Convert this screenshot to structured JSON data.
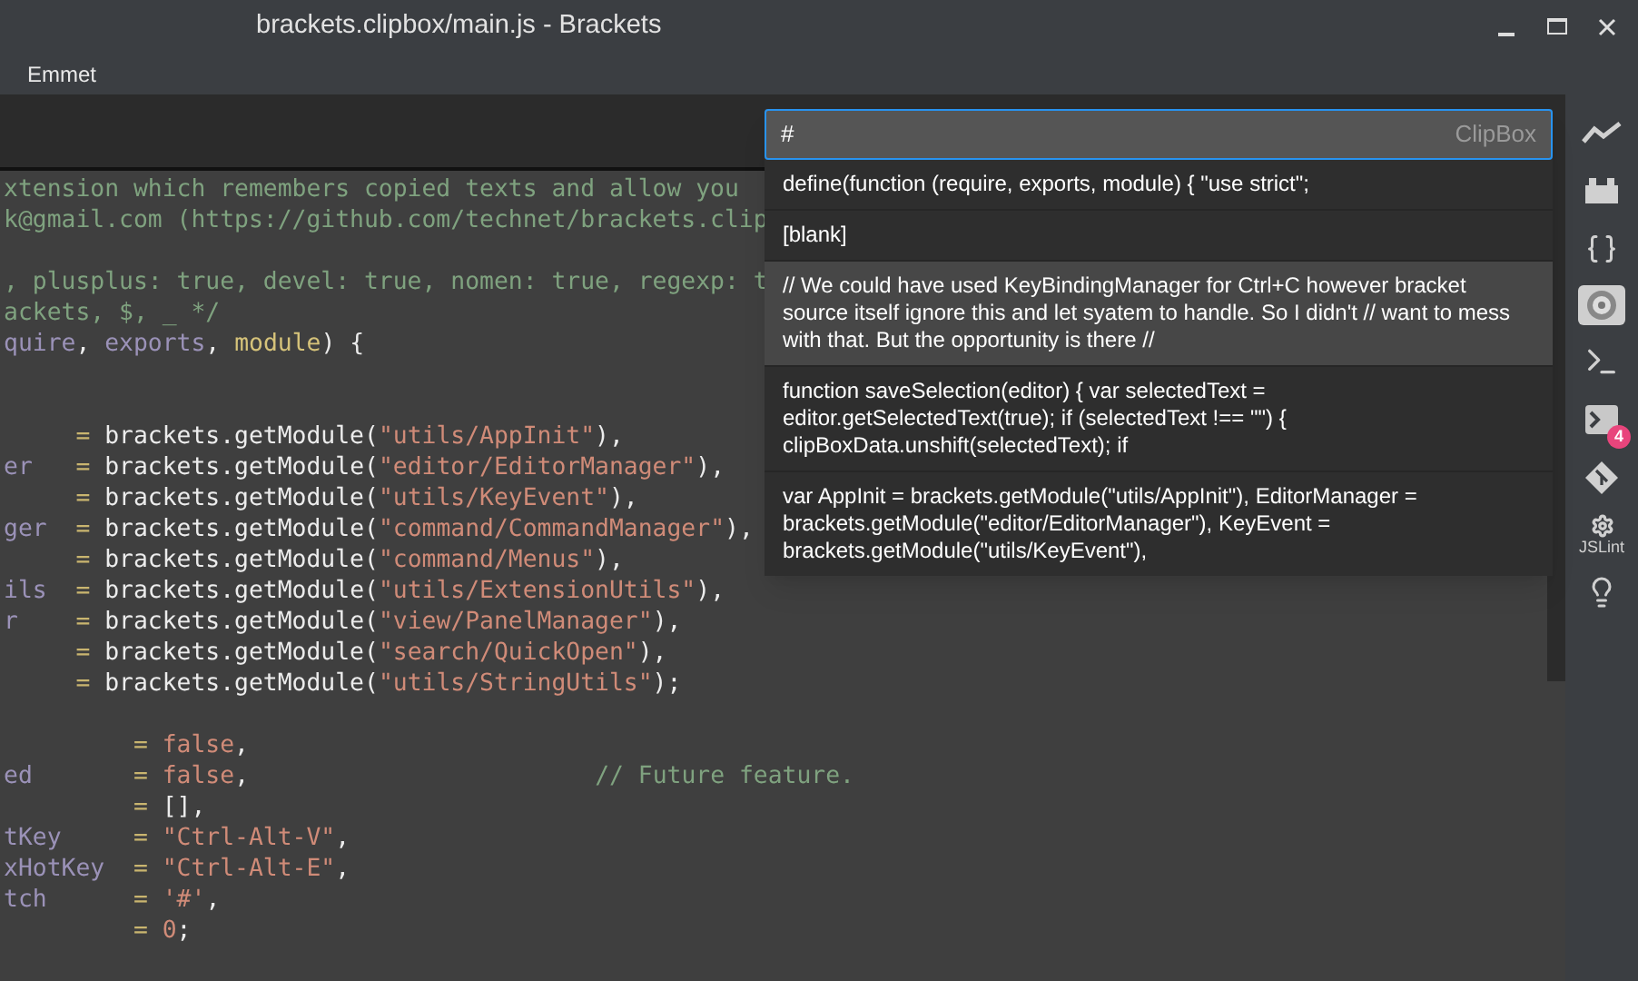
{
  "window": {
    "title": "brackets.clipbox/main.js - Brackets"
  },
  "menu": [
    {
      "label": "Emmet"
    }
  ],
  "editor": {
    "lines": [
      {
        "tokens": [
          {
            "kind": "comment",
            "text": "xtension which remembers copied texts and allow you"
          }
        ]
      },
      {
        "tokens": [
          {
            "kind": "comment",
            "text": "k@gmail.com (https://github.com/technet/brackets.clip"
          }
        ]
      },
      {
        "kind": "blank"
      },
      {
        "tokens": [
          {
            "kind": "comment",
            "text": ", plusplus: true, devel: true, nomen: true, regexp: t"
          }
        ]
      },
      {
        "tokens": [
          {
            "kind": "comment",
            "text": "ackets, $, _ */"
          }
        ]
      },
      {
        "tokens": [
          {
            "kind": "var",
            "text": "quire"
          },
          {
            "kind": "plain",
            "text": ", "
          },
          {
            "kind": "var",
            "text": "exports"
          },
          {
            "kind": "plain",
            "text": ", "
          },
          {
            "kind": "param",
            "text": "module"
          },
          {
            "kind": "plain",
            "text": ") {"
          }
        ]
      },
      {
        "kind": "blank"
      },
      {
        "kind": "blank"
      },
      {
        "tokens": [
          {
            "kind": "op",
            "text": "     = "
          },
          {
            "kind": "plain",
            "text": "brackets.getModule("
          },
          {
            "kind": "string",
            "text": "\"utils/AppInit\""
          },
          {
            "kind": "plain",
            "text": "),"
          }
        ]
      },
      {
        "tokens": [
          {
            "kind": "var",
            "text": "er"
          },
          {
            "kind": "op",
            "text": "   = "
          },
          {
            "kind": "plain",
            "text": "brackets.getModule("
          },
          {
            "kind": "string",
            "text": "\"editor/EditorManager\""
          },
          {
            "kind": "plain",
            "text": "),"
          }
        ]
      },
      {
        "tokens": [
          {
            "kind": "op",
            "text": "     = "
          },
          {
            "kind": "plain",
            "text": "brackets.getModule("
          },
          {
            "kind": "string",
            "text": "\"utils/KeyEvent\""
          },
          {
            "kind": "plain",
            "text": "),"
          }
        ]
      },
      {
        "tokens": [
          {
            "kind": "var",
            "text": "ger"
          },
          {
            "kind": "op",
            "text": "  = "
          },
          {
            "kind": "plain",
            "text": "brackets.getModule("
          },
          {
            "kind": "string",
            "text": "\"command/CommandManager\""
          },
          {
            "kind": "plain",
            "text": "),"
          }
        ]
      },
      {
        "tokens": [
          {
            "kind": "op",
            "text": "     = "
          },
          {
            "kind": "plain",
            "text": "brackets.getModule("
          },
          {
            "kind": "string",
            "text": "\"command/Menus\""
          },
          {
            "kind": "plain",
            "text": "),"
          }
        ]
      },
      {
        "tokens": [
          {
            "kind": "var",
            "text": "ils"
          },
          {
            "kind": "op",
            "text": "  = "
          },
          {
            "kind": "plain",
            "text": "brackets.getModule("
          },
          {
            "kind": "string",
            "text": "\"utils/ExtensionUtils\""
          },
          {
            "kind": "plain",
            "text": "),"
          }
        ]
      },
      {
        "tokens": [
          {
            "kind": "var",
            "text": "r"
          },
          {
            "kind": "op",
            "text": "    = "
          },
          {
            "kind": "plain",
            "text": "brackets.getModule("
          },
          {
            "kind": "string",
            "text": "\"view/PanelManager\""
          },
          {
            "kind": "plain",
            "text": "),"
          }
        ]
      },
      {
        "tokens": [
          {
            "kind": "op",
            "text": "     = "
          },
          {
            "kind": "plain",
            "text": "brackets.getModule("
          },
          {
            "kind": "string",
            "text": "\"search/QuickOpen\""
          },
          {
            "kind": "plain",
            "text": "),"
          }
        ]
      },
      {
        "tokens": [
          {
            "kind": "op",
            "text": "     = "
          },
          {
            "kind": "plain",
            "text": "brackets.getModule("
          },
          {
            "kind": "string",
            "text": "\"utils/StringUtils\""
          },
          {
            "kind": "plain",
            "text": ");"
          }
        ]
      },
      {
        "kind": "blank"
      },
      {
        "tokens": [
          {
            "kind": "op",
            "text": "         = "
          },
          {
            "kind": "string",
            "text": "false"
          },
          {
            "kind": "plain",
            "text": ","
          }
        ]
      },
      {
        "tokens": [
          {
            "kind": "var",
            "text": "ed"
          },
          {
            "kind": "op",
            "text": "       = "
          },
          {
            "kind": "string",
            "text": "false"
          },
          {
            "kind": "plain",
            "text": ",                        "
          },
          {
            "kind": "comment",
            "text": "// Future feature."
          }
        ]
      },
      {
        "tokens": [
          {
            "kind": "op",
            "text": "         = "
          },
          {
            "kind": "plain",
            "text": "[],"
          }
        ]
      },
      {
        "tokens": [
          {
            "kind": "var",
            "text": "tKey"
          },
          {
            "kind": "op",
            "text": "     = "
          },
          {
            "kind": "string",
            "text": "\"Ctrl-Alt-V\""
          },
          {
            "kind": "plain",
            "text": ","
          }
        ]
      },
      {
        "tokens": [
          {
            "kind": "var",
            "text": "xHotKey"
          },
          {
            "kind": "op",
            "text": "  = "
          },
          {
            "kind": "string",
            "text": "\"Ctrl-Alt-E\""
          },
          {
            "kind": "plain",
            "text": ","
          }
        ]
      },
      {
        "tokens": [
          {
            "kind": "var",
            "text": "tch"
          },
          {
            "kind": "op",
            "text": "      = "
          },
          {
            "kind": "string",
            "text": "'#'"
          },
          {
            "kind": "plain",
            "text": ","
          }
        ]
      },
      {
        "tokens": [
          {
            "kind": "op",
            "text": "         = "
          },
          {
            "kind": "string",
            "text": "0"
          },
          {
            "kind": "plain",
            "text": ";"
          }
        ]
      }
    ]
  },
  "clipbox": {
    "query": "#",
    "label": "ClipBox",
    "items": [
      {
        "text": "define(function (require, exports, module) { \"use strict\";",
        "selected": false
      },
      {
        "text": "[blank]",
        "selected": false
      },
      {
        "text": "// We could have used KeyBindingManager for Ctrl+C however bracket source itself ignore this and let syatem to handle. So I didn't // want to mess with that. But the opportunity is there //",
        "selected": true
      },
      {
        "text": "function saveSelection(editor) { var selectedText = editor.getSelectedText(true); if (selectedText !== \"\") { clipBoxData.unshift(selectedText); if",
        "selected": false
      },
      {
        "text": "var AppInit = brackets.getModule(\"utils/AppInit\"), EditorManager = brackets.getModule(\"editor/EditorManager\"), KeyEvent = brackets.getModule(\"utils/KeyEvent\"),",
        "selected": false
      }
    ]
  },
  "sidebar": [
    {
      "kind": "graph",
      "selected": false
    },
    {
      "kind": "brick",
      "selected": false
    },
    {
      "kind": "braces",
      "selected": false
    },
    {
      "kind": "disc",
      "selected": true
    },
    {
      "kind": "terminal",
      "selected": false
    },
    {
      "kind": "terminal-badge",
      "badge": "4",
      "selected": false
    },
    {
      "kind": "git",
      "selected": false
    },
    {
      "kind": "gear-label",
      "label": "JSLint",
      "selected": false
    },
    {
      "kind": "bulb",
      "selected": false
    }
  ]
}
